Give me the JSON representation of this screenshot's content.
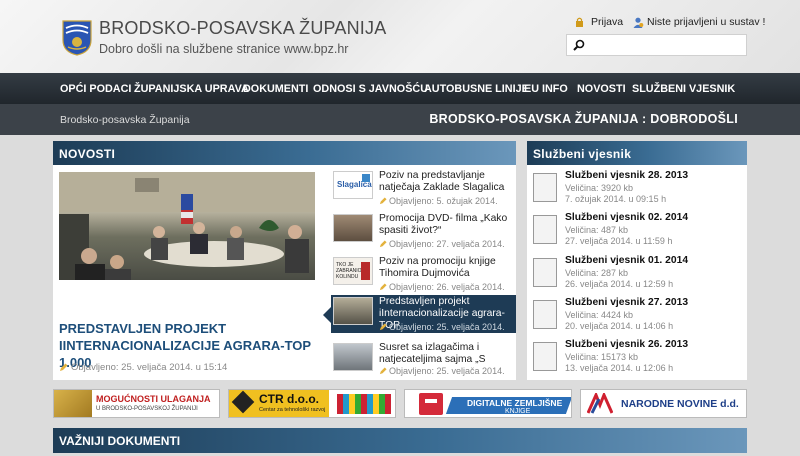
{
  "header": {
    "title": "BRODSKO-POSAVSKA ŽUPANIJA",
    "subtitle": "Dobro došli na službene stranice www.bpz.hr",
    "login": "Prijava",
    "not_logged": "Niste prijavljeni u sustav !",
    "search_placeholder": ""
  },
  "nav": [
    "OPĆI PODACI",
    "ŽUPANIJSKA UPRAVA",
    "DOKUMENTI",
    "ODNOSI S JAVNOŠĆU",
    "AUTOBUSNE LINIJE",
    "EU INFO",
    "NOVOSTI",
    "SLUŽBENI VJESNIK"
  ],
  "breadcrumb": "Brodsko-posavska Županija",
  "welcome": "BRODSKO-POSAVSKA ŽUPANIJA : DOBRODOŠLI",
  "news": {
    "heading": "NOVOSTI",
    "featured": {
      "title": "PREDSTAVLJEN PROJEKT IINTERNACIONALIZACIJE AGRARA-TOP 1.000",
      "meta": "Objavljeno: 25. veljača 2014. u 15:14"
    },
    "items": [
      {
        "title": "Poziv na predstavljanje natječaja Zaklade Slagalica",
        "meta": "Objavljeno: 5. ožujak 2014.",
        "thumb_text": "Slagalica"
      },
      {
        "title": "Promocija DVD- filma „Kako spasiti život?“",
        "meta": "Objavljeno: 27. veljača 2014.",
        "thumb_text": ""
      },
      {
        "title": "Poziv na promociju knjige Tihomira Dujmovića",
        "meta": "Objavljeno: 26. veljača 2014.",
        "thumb_text": "TKO JE ZABRANIO KOLINDU"
      },
      {
        "title": "Predstavljen projekt iInternacionalizacije agrara-TOP",
        "meta": "Objavljeno: 25. veljača 2014.",
        "thumb_text": ""
      },
      {
        "title": "Susret sa izlagačima i natjecateljima sajma „S",
        "meta": "Objavljeno: 25. veljača 2014.",
        "thumb_text": ""
      }
    ]
  },
  "vjesnik": {
    "heading": "Službeni vjesnik",
    "items": [
      {
        "title": "Službeni vjesnik 28. 2013",
        "size": "Veličina: 3920 kb",
        "date": "7. ožujak 2014. u 09:15 h"
      },
      {
        "title": "Službeni vjesnik 02. 2014",
        "size": "Veličina: 487 kb",
        "date": "27. veljača 2014. u 11:59 h"
      },
      {
        "title": "Službeni vjesnik 01. 2014",
        "size": "Veličina: 287 kb",
        "date": "26. veljača 2014. u 12:59 h"
      },
      {
        "title": "Službeni vjesnik 27. 2013",
        "size": "Veličina: 4424 kb",
        "date": "20. veljača 2014. u 14:06 h"
      },
      {
        "title": "Službeni vjesnik 26. 2013",
        "size": "Veličina: 15173 kb",
        "date": "13. veljača 2014. u 12:06 h"
      }
    ]
  },
  "banners": {
    "b1_big": "MOGUĆNOSTI ULAGANJA",
    "b1_small": "U BRODSKO-POSAVSKOJ ŽUPANIJI",
    "b2_name": "CTR d.o.o.",
    "b2_sub": "Centar za tehnološki razvoj",
    "b3_line1": "DIGITALNE ZEMLJIŠNE",
    "b3_line2": "KNJIGE",
    "b4": "NARODNE NOVINE d.d."
  },
  "docs_heading": "VAŽNIJI DOKUMENTI",
  "colors": {
    "nav": "#2a3138",
    "panel_dark": "#1d3c56",
    "link_blue": "#1d4e7a"
  }
}
